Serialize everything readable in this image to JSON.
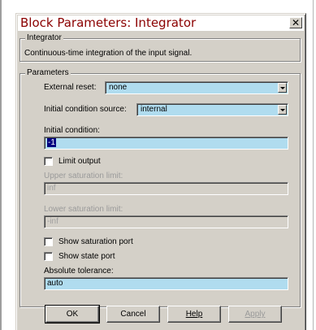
{
  "window": {
    "title": "Block Parameters: Integrator",
    "close_glyph": "✕"
  },
  "block_group": {
    "label": "Integrator",
    "description": "Continuous-time integration of the input signal."
  },
  "params_group": {
    "label": "Parameters",
    "external_reset": {
      "label": "External reset:",
      "value": "none"
    },
    "ic_source": {
      "label": "Initial condition source:",
      "value": "internal"
    },
    "initial_condition": {
      "label": "Initial condition:",
      "value": "-1"
    },
    "limit_output": {
      "label": "Limit output",
      "checked": false
    },
    "upper_sat": {
      "label": "Upper saturation limit:",
      "value": "inf"
    },
    "lower_sat": {
      "label": "Lower saturation limit:",
      "value": "-inf"
    },
    "show_sat_port": {
      "label": "Show saturation port",
      "checked": false
    },
    "show_state_port": {
      "label": "Show state port",
      "checked": false
    },
    "abs_tol": {
      "label": "Absolute tolerance:",
      "value": "auto"
    }
  },
  "buttons": {
    "ok": "OK",
    "cancel": "Cancel",
    "help": "Help",
    "apply": "Apply"
  }
}
